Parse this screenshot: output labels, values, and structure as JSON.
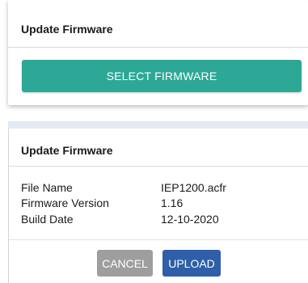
{
  "select_card": {
    "title": "Update Firmware",
    "select_button_label": "SELECT FIRMWARE"
  },
  "details_panel": {
    "title": "Update Firmware",
    "rows": [
      {
        "label": "File Name",
        "value": "IEP1200.acfr"
      },
      {
        "label": "Firmware Version",
        "value": "1.16"
      },
      {
        "label": "Build Date",
        "value": "12-10-2020"
      }
    ],
    "cancel_label": "CANCEL",
    "upload_label": "UPLOAD"
  },
  "colors": {
    "select_button": "#2ea896",
    "cancel_button": "#9e9e9e",
    "upload_button": "#2e5fa8"
  }
}
